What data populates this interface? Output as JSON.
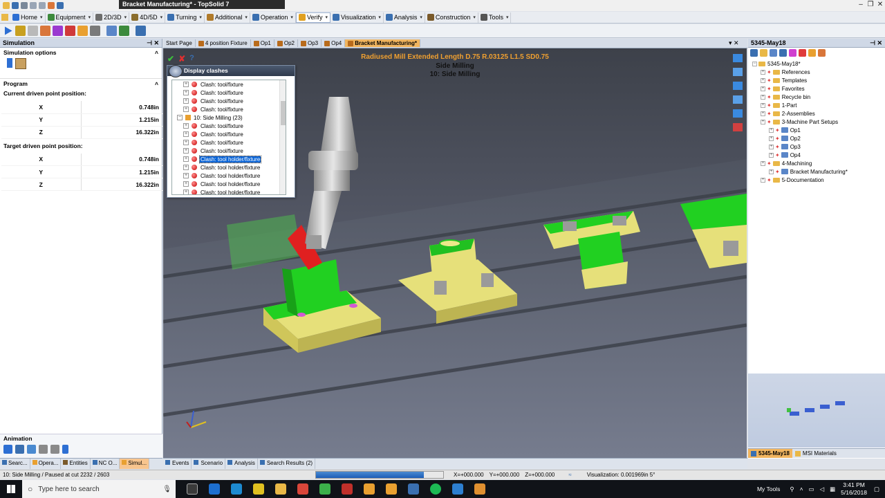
{
  "window": {
    "title": "Bracket Manufacturing* - TopSolid 7"
  },
  "menu": [
    {
      "label": "Home",
      "color": "#2d6fd3"
    },
    {
      "label": "Equipment",
      "color": "#3c8a3c"
    },
    {
      "label": "2D/3D",
      "color": "#6d6d6d"
    },
    {
      "label": "4D/5D",
      "color": "#8a6d2d"
    },
    {
      "label": "Turning",
      "color": "#3a6fb0"
    },
    {
      "label": "Additional",
      "color": "#b07a2a"
    },
    {
      "label": "Operation",
      "color": "#3a6fb0"
    },
    {
      "label": "Verify",
      "color": "#e0a020",
      "active": true
    },
    {
      "label": "Visualization",
      "color": "#3a6fb0"
    },
    {
      "label": "Analysis",
      "color": "#3a6fb0"
    },
    {
      "label": "Construction",
      "color": "#7a5a2a"
    },
    {
      "label": "Tools",
      "color": "#555555"
    }
  ],
  "left": {
    "panel_title": "Simulation",
    "sim_options": "Simulation options",
    "program": "Program",
    "current_label": "Current driven point position:",
    "current": [
      {
        "axis": "X",
        "value": "0.748in"
      },
      {
        "axis": "Y",
        "value": "1.215in"
      },
      {
        "axis": "Z",
        "value": "16.322in"
      }
    ],
    "target_label": "Target driven point position:",
    "target": [
      {
        "axis": "X",
        "value": "0.748in"
      },
      {
        "axis": "Y",
        "value": "1.215in"
      },
      {
        "axis": "Z",
        "value": "16.322in"
      }
    ],
    "animation": "Animation",
    "tabs": [
      "Searc...",
      "Opera...",
      "Entities",
      "NC O...",
      "Simul..."
    ]
  },
  "doc_tabs": [
    "Start Page",
    "4 position Fixture",
    "Op1",
    "Op2",
    "Op3",
    "Op4",
    "Bracket Manufacturing*"
  ],
  "viewport": {
    "tool_line": "Radiused Mill Extended Length D.75 R.03125 L1.5 SD0.75",
    "op_name": "Side Milling",
    "op_step": "10: Side Milling"
  },
  "dialog": {
    "title": "Display clashes",
    "rows": [
      {
        "label": "Clash: tool/fixture"
      },
      {
        "label": "Clash: tool/fixture"
      },
      {
        "label": "Clash: tool/fixture"
      },
      {
        "label": "Clash: tool/fixture"
      },
      {
        "label": "10: Side Milling (23)",
        "group": true
      },
      {
        "label": "Clash: tool/fixture"
      },
      {
        "label": "Clash: tool/fixture"
      },
      {
        "label": "Clash: tool/fixture"
      },
      {
        "label": "Clash: tool/fixture"
      },
      {
        "label": "Clash: tool holder/fixture",
        "selected": true
      },
      {
        "label": "Clash: tool holder/fixture"
      },
      {
        "label": "Clash: tool holder/fixture"
      },
      {
        "label": "Clash: tool holder/fixture"
      },
      {
        "label": "Clash: tool holder/fixture"
      }
    ]
  },
  "right": {
    "panel_title": "5345-May18",
    "tree": [
      {
        "label": "5345-May18*",
        "level": 0,
        "kind": "root"
      },
      {
        "label": "References",
        "level": 1,
        "kind": "fold"
      },
      {
        "label": "Templates",
        "level": 1,
        "kind": "fold"
      },
      {
        "label": "Favorites",
        "level": 1,
        "kind": "fold"
      },
      {
        "label": "Recycle bin",
        "level": 1,
        "kind": "fold"
      },
      {
        "label": "1-Part",
        "level": 1,
        "kind": "fold"
      },
      {
        "label": "2-Assemblies",
        "level": 1,
        "kind": "fold"
      },
      {
        "label": "3-Machine Part Setups",
        "level": 1,
        "kind": "fold"
      },
      {
        "label": "Op1",
        "level": 2,
        "kind": "op"
      },
      {
        "label": "Op2",
        "level": 2,
        "kind": "op"
      },
      {
        "label": "Op3",
        "level": 2,
        "kind": "op"
      },
      {
        "label": "Op4",
        "level": 2,
        "kind": "op"
      },
      {
        "label": "4-Machining",
        "level": 1,
        "kind": "fold"
      },
      {
        "label": "Bracket Manufacturing*",
        "level": 2,
        "kind": "op"
      },
      {
        "label": "5-Documentation",
        "level": 1,
        "kind": "fold"
      }
    ],
    "tabs": [
      "5345-May18",
      "MSI Materials"
    ]
  },
  "bottom_tabs": [
    "Events",
    "Scenario",
    "Analysis",
    "Search Results (2)"
  ],
  "status": {
    "left": "10: Side Milling / Paused at cut 2232 / 2603",
    "x": "X=+000.000",
    "y": "Y=+000.000",
    "z": "Z=+000.000",
    "vis": "Visualization: 0.001969in 5°",
    "progress": 0.85
  },
  "taskbar": {
    "search_placeholder": "Type here to search",
    "my_tools": "My Tools",
    "time": "3:41 PM",
    "date": "5/16/2018"
  }
}
